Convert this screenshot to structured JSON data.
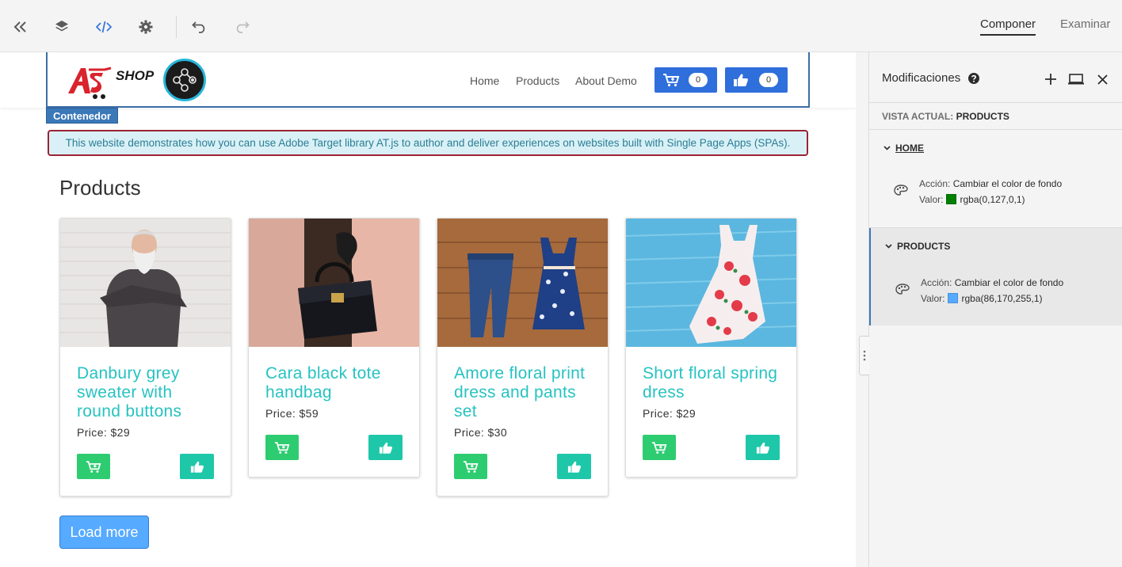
{
  "toolbar": {
    "collapse_icon": "double-chevron-left-icon",
    "layers_icon": "layers-icon",
    "code_icon": "code-icon",
    "settings_icon": "gear-icon",
    "undo_icon": "undo-icon",
    "redo_icon": "redo-icon",
    "modes": [
      {
        "label": "Componer",
        "active": true
      },
      {
        "label": "Examinar",
        "active": false
      }
    ]
  },
  "site": {
    "logo_text": "SHOP",
    "nav": [
      "Home",
      "Products",
      "About Demo"
    ],
    "cart_count": "0",
    "like_count": "0",
    "selection_label": "Contenedor",
    "alert_text": "This website demonstrates how you can use Adobe Target library AT.js to author and deliver experiences on websites built with Single Page Apps (SPAs).",
    "products_title": "Products",
    "products": [
      {
        "title": "Danbury grey sweater with round buttons",
        "price": "Price: $29",
        "image": "man-in-grey-sweater"
      },
      {
        "title": "Cara black tote handbag",
        "price": "Price: $59",
        "image": "black-handbag"
      },
      {
        "title": "Amore floral print dress and pants set",
        "price": "Price: $30",
        "image": "jeans-and-floral-dress"
      },
      {
        "title": "Short floral spring dress",
        "price": "Price: $29",
        "image": "floral-dress-on-blue-wood"
      }
    ],
    "load_more": "Load more",
    "colors": {
      "cart_button": "#2ecc71",
      "like_button": "#1fc7a9",
      "title": "#27c2c2",
      "header_button": "#2f6fdc"
    }
  },
  "panel": {
    "title": "Modificaciones",
    "help_icon": "question-circle-icon",
    "add_icon": "plus-icon",
    "device_icon": "laptop-icon",
    "close_icon": "close-icon",
    "current_view_label": "VISTA ACTUAL:",
    "current_view_value": "PRODUCTS",
    "sections": [
      {
        "name": "HOME",
        "action_label": "Acción:",
        "action_value": "Cambiar el color de fondo",
        "value_label": "Valor:",
        "value": "rgba(0,127,0,1)",
        "swatch": "#007f00"
      },
      {
        "name": "PRODUCTS",
        "action_label": "Acción:",
        "action_value": "Cambiar el color de fondo",
        "value_label": "Valor:",
        "value": "rgba(86,170,255,1)",
        "swatch": "#56aaff"
      }
    ]
  }
}
